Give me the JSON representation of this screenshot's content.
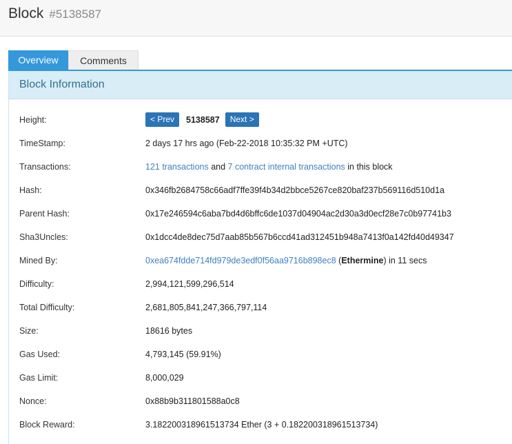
{
  "header": {
    "title": "Block",
    "block_id": "#5138587"
  },
  "tabs": [
    {
      "label": "Overview",
      "active": true
    },
    {
      "label": "Comments",
      "active": false
    }
  ],
  "panel": {
    "title": "Block Information"
  },
  "height": {
    "label": "Height:",
    "prev": "< Prev",
    "value": "5138587",
    "next": "Next >"
  },
  "timestamp": {
    "label": "TimeStamp:",
    "value": "2 days 17 hrs ago (Feb-22-2018 10:35:32 PM +UTC)"
  },
  "transactions": {
    "label": "Transactions:",
    "tx_link": "121 transactions",
    "and": " and ",
    "internal_link": "7 contract internal transactions",
    "suffix": " in this block"
  },
  "hash": {
    "label": "Hash:",
    "value": "0x346fb2684758c66adf7ffe39f4b34d2bbce5267ce820baf237b569116d510d1a"
  },
  "parent_hash": {
    "label": "Parent Hash:",
    "value": "0x17e246594c6aba7bd4d6bffc6de1037d04904ac2d30a3d0ecf28e7c0b97741b3"
  },
  "sha3uncles": {
    "label": "Sha3Uncles:",
    "value": "0x1dcc4de8dec75d7aab85b567b6ccd41ad312451b948a7413f0a142fd40d49347"
  },
  "mined_by": {
    "label": "Mined By:",
    "address": "0xea674fdde714fd979de3edf0f56aa9716b898ec8",
    "open": " (",
    "pool": "Ethermine",
    "close": ") in 11 secs"
  },
  "difficulty": {
    "label": "Difficulty:",
    "value": "2,994,121,599,296,514"
  },
  "total_difficulty": {
    "label": "Total Difficulty:",
    "value": "2,681,805,841,247,366,797,114"
  },
  "size": {
    "label": "Size:",
    "value": "18616 bytes"
  },
  "gas_used": {
    "label": "Gas Used:",
    "value": "4,793,145 (59.91%)"
  },
  "gas_limit": {
    "label": "Gas Limit:",
    "value": "8,000,029"
  },
  "nonce": {
    "label": "Nonce:",
    "value": "0x88b9b311801588a0c8"
  },
  "block_reward": {
    "label": "Block Reward:",
    "value": "3.182200318961513734 Ether (3 + 0.182200318961513734)"
  }
}
